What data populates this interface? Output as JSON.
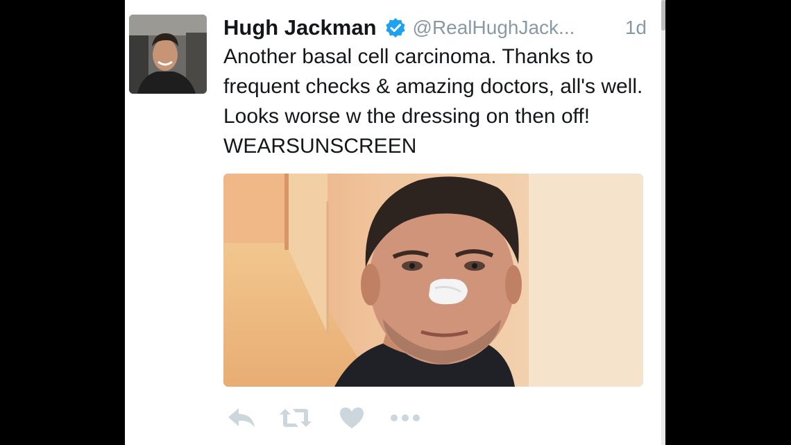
{
  "tweet": {
    "display_name": "Hugh Jackman",
    "verified": true,
    "handle": "@RealHughJack...",
    "timestamp": "1d",
    "text": "Another basal cell carcinoma. Thanks to frequent checks & amazing doctors, all's well. Looks worse w the dressing on then off! WEARSUNSCREEN",
    "avatar_icon": "profile-photo",
    "photo_icon": "selfie-photo-nose-bandage"
  },
  "actions": [
    {
      "name": "reply",
      "icon": "reply-icon"
    },
    {
      "name": "retweet",
      "icon": "retweet-icon"
    },
    {
      "name": "like",
      "icon": "heart-icon"
    },
    {
      "name": "more",
      "icon": "more-icon"
    }
  ],
  "colors": {
    "name_text": "#14171a",
    "muted_text": "#8899a6",
    "verified_badge": "#1da1f2",
    "action_icons": "#ccd6dd",
    "frame": "#000000"
  }
}
